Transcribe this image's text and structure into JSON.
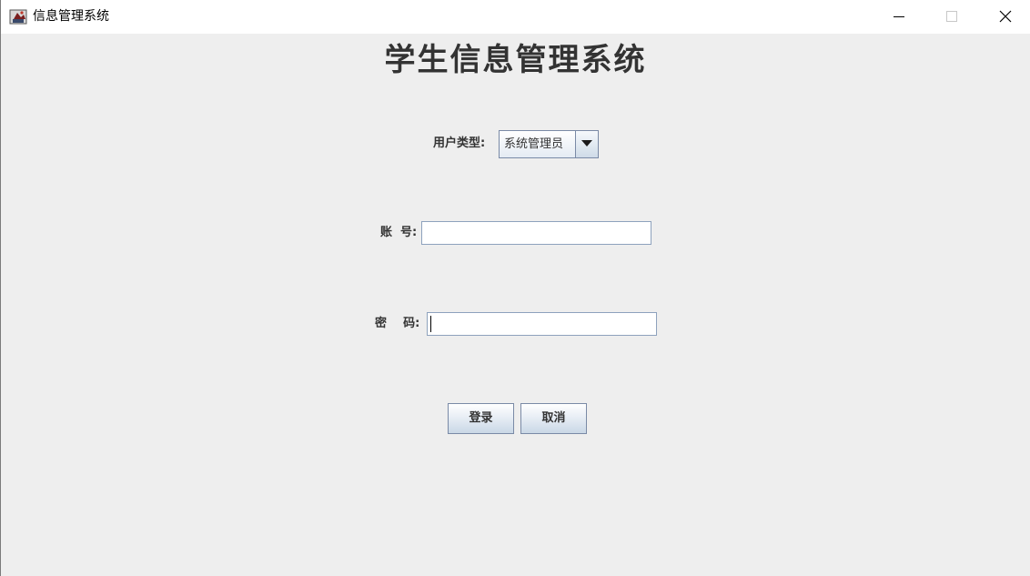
{
  "window": {
    "title": "信息管理系统",
    "app_icon": "java-cup-icon",
    "controls": [
      "minimize-icon",
      "maximize-icon",
      "close-icon"
    ]
  },
  "main": {
    "heading": "学生信息管理系统"
  },
  "form": {
    "user_type_label": "用户类型:",
    "user_type_value": "系统管理员",
    "account_label": "账  号:",
    "account_value": "",
    "password_label": "密    码:",
    "password_value": "",
    "login_button": "登录",
    "cancel_button": "取消"
  },
  "colors": {
    "background": "#eeeeee",
    "titlebar": "#ffffff",
    "field_border": "#8ea2bd",
    "button_border": "#7a8aa6"
  }
}
